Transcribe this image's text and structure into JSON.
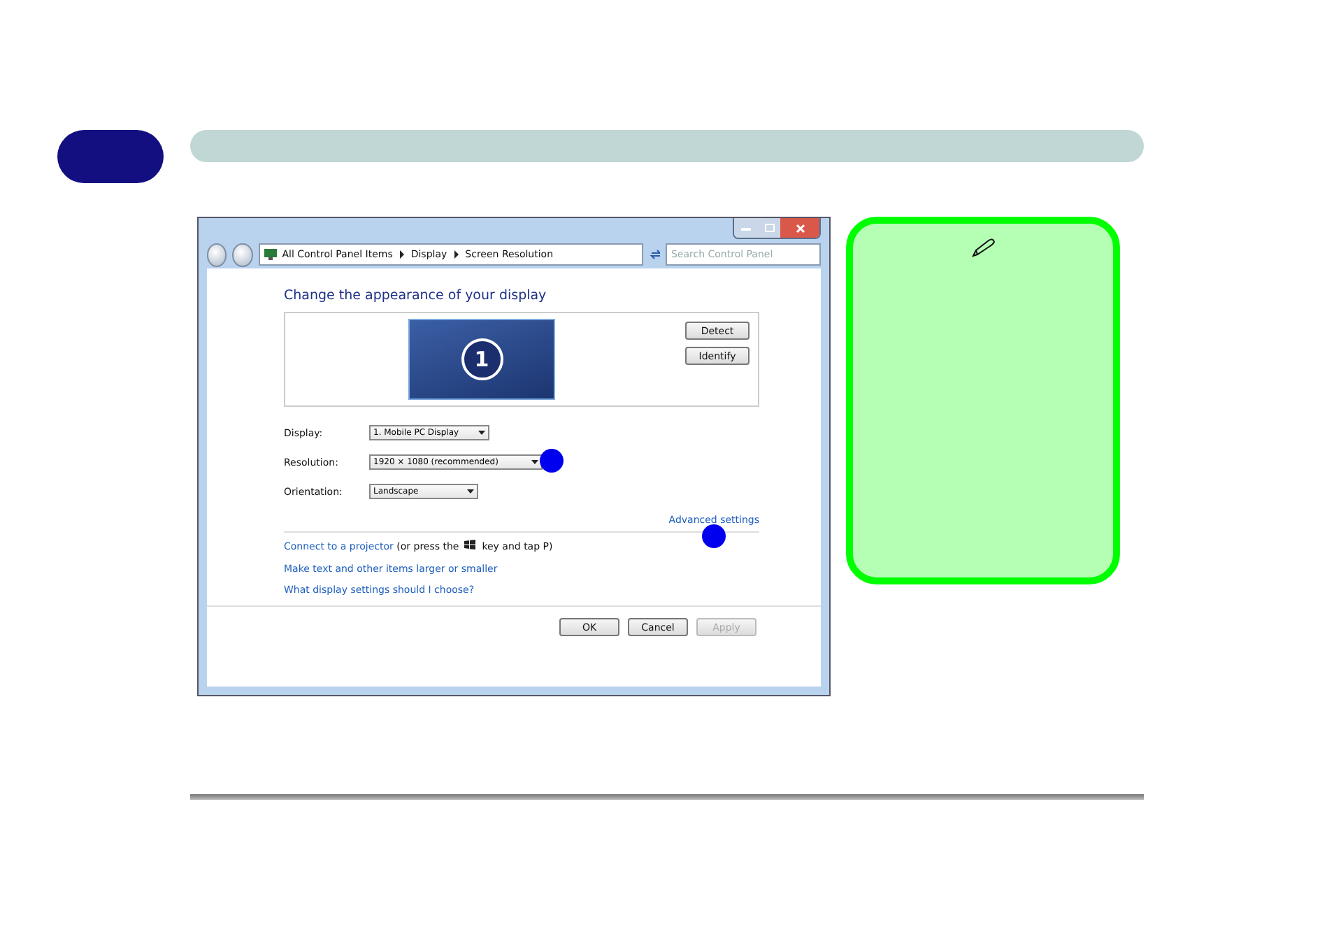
{
  "window": {
    "breadcrumb": [
      "All Control Panel Items",
      "Display",
      "Screen Resolution"
    ],
    "search": {
      "placeholder": "Search Control Panel"
    },
    "heading": "Change the appearance of your display",
    "monitor_number": "1",
    "preview_buttons": [
      {
        "label": "Detect"
      },
      {
        "label": "Identify"
      }
    ],
    "settings": [
      {
        "label": "Display:",
        "value": "1. Mobile PC Display"
      },
      {
        "label": "Resolution:",
        "value": "1920 × 1080 (recommended)"
      },
      {
        "label": "Orientation:",
        "value": "Landscape"
      }
    ],
    "advanced_link": "Advanced settings",
    "projector": {
      "link": "Connect to a projector",
      "before_icon": " (or press the ",
      "after_icon": " key and tap P)"
    },
    "links": [
      "Make text and other items larger or smaller",
      "What display settings should I choose?"
    ],
    "buttons": [
      {
        "label": "OK",
        "disabled": false
      },
      {
        "label": "Cancel",
        "disabled": false
      },
      {
        "label": "Apply",
        "disabled": true
      }
    ]
  }
}
